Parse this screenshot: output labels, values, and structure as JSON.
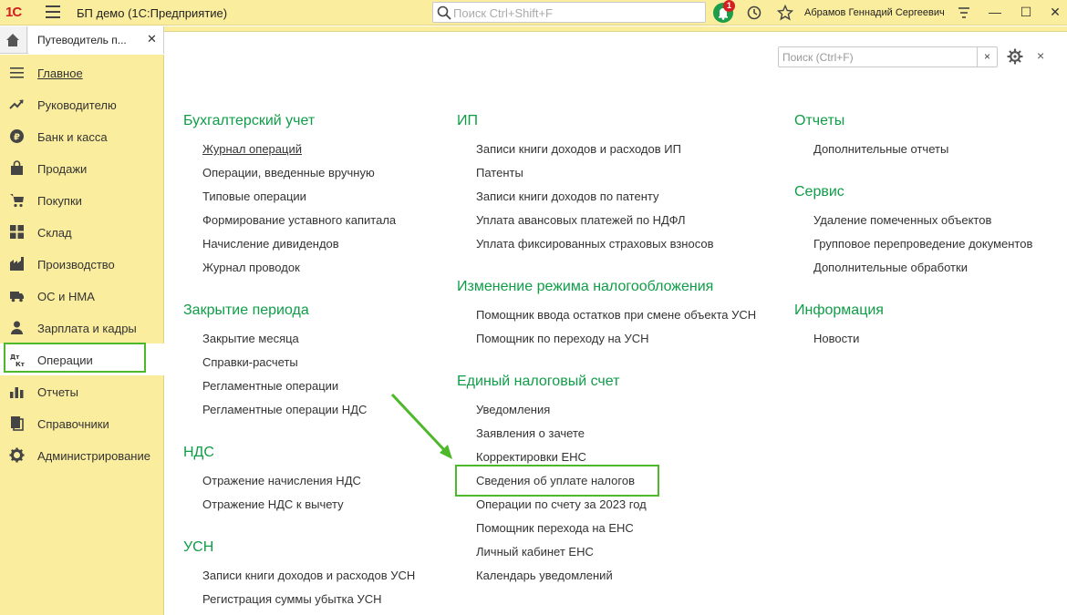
{
  "titlebar": {
    "logo": "1С",
    "app_title": "БП демо  (1С:Предприятие)",
    "search_placeholder": "Поиск Ctrl+Shift+F",
    "notifications_count": "1",
    "user_name": "Абрамов Геннадий Сергеевич",
    "accent_color": "#fbed9e"
  },
  "tab": {
    "label": "Путеводитель п...",
    "close": "✕"
  },
  "sidebar": {
    "items": [
      {
        "label": "Главное",
        "icon": "menu-lines-icon"
      },
      {
        "label": "Руководителю",
        "icon": "trend-icon"
      },
      {
        "label": "Банк и касса",
        "icon": "ruble-coin-icon"
      },
      {
        "label": "Продажи",
        "icon": "bag-icon"
      },
      {
        "label": "Покупки",
        "icon": "cart-icon"
      },
      {
        "label": "Склад",
        "icon": "warehouse-grid-icon"
      },
      {
        "label": "Производство",
        "icon": "factory-icon"
      },
      {
        "label": "ОС и НМА",
        "icon": "truck-icon"
      },
      {
        "label": "Зарплата и кадры",
        "icon": "person-icon"
      },
      {
        "label": "Операции",
        "icon": "dt-kt-icon"
      },
      {
        "label": "Отчеты",
        "icon": "bar-chart-icon"
      },
      {
        "label": "Справочники",
        "icon": "books-icon"
      },
      {
        "label": "Администрирование",
        "icon": "gear-icon"
      }
    ]
  },
  "main": {
    "search_placeholder": "Поиск (Ctrl+F)",
    "search_clear": "×",
    "close": "×",
    "sections": {
      "accounting": {
        "title": "Бухгалтерский учет",
        "links": [
          "Журнал операций",
          "Операции, введенные вручную",
          "Типовые операции",
          "Формирование уставного капитала",
          "Начисление дивидендов",
          "Журнал проводок"
        ]
      },
      "closing": {
        "title": "Закрытие периода",
        "links": [
          "Закрытие месяца",
          "Справки-расчеты",
          "Регламентные операции",
          "Регламентные операции НДС"
        ]
      },
      "vat": {
        "title": "НДС",
        "links": [
          "Отражение начисления НДС",
          "Отражение НДС к вычету"
        ]
      },
      "usn": {
        "title": "УСН",
        "links": [
          "Записи книги доходов и расходов УСН",
          "Регистрация суммы убытка УСН"
        ]
      },
      "ip": {
        "title": "ИП",
        "links": [
          "Записи книги доходов и расходов ИП",
          "Патенты",
          "Записи книги доходов по патенту",
          "Уплата авансовых платежей по НДФЛ",
          "Уплата фиксированных страховых взносов"
        ]
      },
      "tax_mode": {
        "title": "Изменение режима налогообложения",
        "links": [
          "Помощник ввода остатков при смене объекта УСН",
          "Помощник по переходу на УСН"
        ]
      },
      "ens": {
        "title": "Единый налоговый счет",
        "links": [
          "Уведомления",
          "Заявления о зачете",
          "Корректировки ЕНС",
          "Сведения об уплате налогов",
          "Операции по счету за 2023 год",
          "Помощник перехода на ЕНС",
          "Личный кабинет ЕНС",
          "Календарь уведомлений"
        ]
      },
      "reports": {
        "title": "Отчеты",
        "links": [
          "Дополнительные отчеты"
        ]
      },
      "service": {
        "title": "Сервис",
        "links": [
          "Удаление помеченных объектов",
          "Групповое перепроведение документов",
          "Дополнительные обработки"
        ]
      },
      "info": {
        "title": "Информация",
        "links": [
          "Новости"
        ]
      }
    },
    "section_color": "#0f9d47",
    "highlight_color": "#4cb82a"
  }
}
